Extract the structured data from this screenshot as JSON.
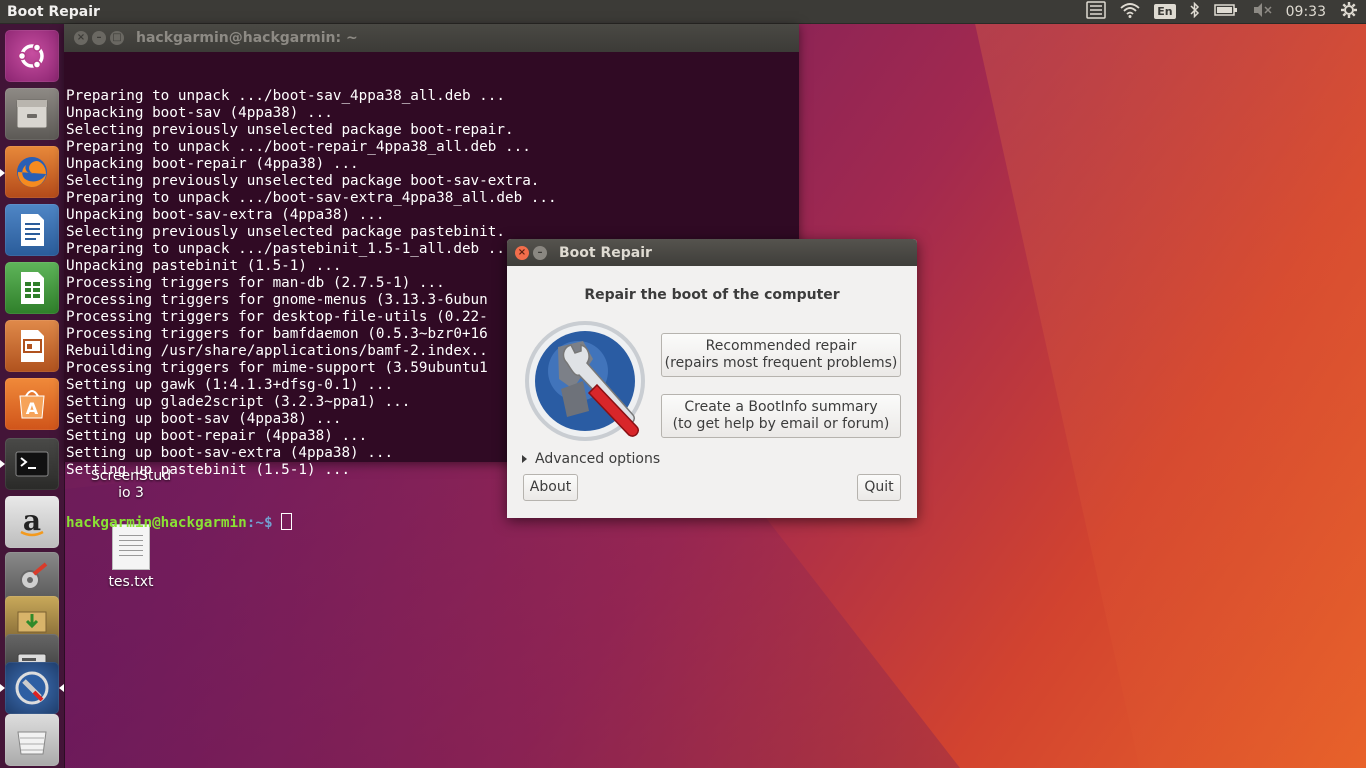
{
  "top_panel": {
    "app_title": "Boot Repair",
    "keyboard_layout": "En",
    "clock": "09:33"
  },
  "terminal": {
    "title": "hackgarmin@hackgarmin: ~",
    "lines": [
      "Preparing to unpack .../boot-sav_4ppa38_all.deb ...",
      "Unpacking boot-sav (4ppa38) ...",
      "Selecting previously unselected package boot-repair.",
      "Preparing to unpack .../boot-repair_4ppa38_all.deb ...",
      "Unpacking boot-repair (4ppa38) ...",
      "Selecting previously unselected package boot-sav-extra.",
      "Preparing to unpack .../boot-sav-extra_4ppa38_all.deb ...",
      "Unpacking boot-sav-extra (4ppa38) ...",
      "Selecting previously unselected package pastebinit.",
      "Preparing to unpack .../pastebinit_1.5-1_all.deb ...",
      "Unpacking pastebinit (1.5-1) ...",
      "Processing triggers for man-db (2.7.5-1) ...",
      "Processing triggers for gnome-menus (3.13.3-6ubun",
      "Processing triggers for desktop-file-utils (0.22-",
      "Processing triggers for bamfdaemon (0.5.3~bzr0+16",
      "Rebuilding /usr/share/applications/bamf-2.index..",
      "Processing triggers for mime-support (3.59ubuntu1",
      "Setting up gawk (1:4.1.3+dfsg-0.1) ...",
      "Setting up glade2script (3.2.3~ppa1) ...",
      "Setting up boot-sav (4ppa38) ...",
      "Setting up boot-repair (4ppa38) ...",
      "Setting up boot-sav-extra (4ppa38) ...",
      "Setting up pastebinit (1.5-1) ..."
    ],
    "prompt_user": "hackgarmin@hackgarmin",
    "prompt_path": ":~$ "
  },
  "desktop": {
    "icons": [
      {
        "label": "ScreenStud\nio 3"
      },
      {
        "label": "tes.txt"
      }
    ]
  },
  "dialog": {
    "title": "Boot Repair",
    "heading": "Repair the boot of the computer",
    "recommended_line1": "Recommended repair",
    "recommended_line2": "(repairs most frequent problems)",
    "bootinfo_line1": "Create a BootInfo summary",
    "bootinfo_line2": "(to get help by email or forum)",
    "advanced_options": "Advanced options",
    "about": "About",
    "quit": "Quit"
  },
  "launcher": {
    "icons": [
      "ubuntu-dash-icon",
      "files-icon",
      "firefox-icon",
      "writer-icon",
      "calc-icon",
      "impress-icon",
      "software-center-icon",
      "terminal-icon",
      "amazon-icon",
      "system-settings-icon",
      "update-manager-icon",
      "disks-icon",
      "boot-repair-icon",
      "trash-icon"
    ]
  },
  "colors": {
    "terminal_bg": "#300a24",
    "prompt_user": "#8ae234",
    "prompt_path": "#729fcf",
    "panel_bg": "#3c3b37",
    "dialog_bg": "#f2f1f0",
    "close_button": "#f26d4b"
  }
}
